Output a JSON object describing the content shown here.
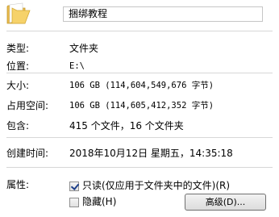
{
  "folder_name": "捆绑教程",
  "properties": {
    "type_label": "类型:",
    "type_value": "文件夹",
    "location_label": "位置:",
    "location_value": "E:\\",
    "size_label": "大小:",
    "size_value": "106 GB (114,604,549,676 字节)",
    "disk_size_label": "占用空间:",
    "disk_size_value": "106 GB (114,605,412,352 字节)",
    "contains_label": "包含:",
    "contains_value": "415 个文件，16 个文件夹",
    "created_label": "创建时间:",
    "created_value": "2018年10月12日 星期五，14:35:18"
  },
  "attributes": {
    "label": "属性:",
    "readonly_label": "只读(仅应用于文件夹中的文件)(R)",
    "readonly_checked": true,
    "hidden_label": "隐藏(H)",
    "hidden_checked": false,
    "advanced_button": "高级(D)..."
  },
  "icons": {
    "folder": "folder-icon"
  },
  "colors": {
    "folder_yellow": "#f6d26a",
    "separator": "#d7d7d7"
  }
}
